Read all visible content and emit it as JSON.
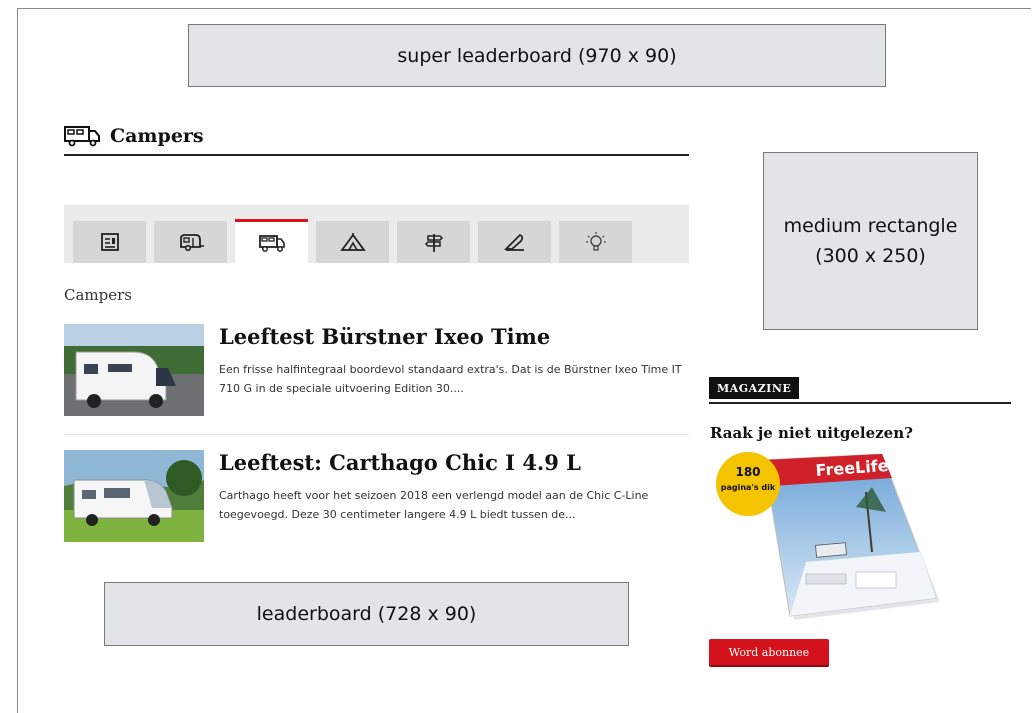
{
  "ads": {
    "super_leaderboard": "super leaderboard (970 x 90)",
    "medium_rectangle": "medium rectangle (300 x 250)",
    "leaderboard": "leaderboard (728 x 90)"
  },
  "section": {
    "title": "Campers",
    "icon": "camper-icon"
  },
  "tabs": [
    {
      "icon": "news-icon",
      "active": false
    },
    {
      "icon": "caravan-icon",
      "active": false
    },
    {
      "icon": "camper-icon",
      "active": true
    },
    {
      "icon": "tent-icon",
      "active": false
    },
    {
      "icon": "signpost-icon",
      "active": false
    },
    {
      "icon": "knife-icon",
      "active": false
    },
    {
      "icon": "lightbulb-icon",
      "active": false
    }
  ],
  "breadcrumb": "Campers",
  "articles": [
    {
      "title": "Leeftest Bürstner Ixeo Time",
      "excerpt": "Een frisse halfintegraal boordevol standaard extra's. Dat is de Bürstner Ixeo Time IT 710 G in de speciale uitvoering Edition 30...."
    },
    {
      "title": "Leeftest: Carthago Chic I 4.9 L",
      "excerpt": "Carthago heeft voor het seizoen 2018 een verlengd model aan de Chic C-Line toegevoegd. Deze 30 centimeter langere 4.9 L biedt tussen de..."
    }
  ],
  "magazine": {
    "label": "MAGAZINE",
    "heading": "Raak je niet uitgelezen?",
    "badge_number": "180",
    "badge_text": "pagina's dik",
    "brand": "FreeLife",
    "button": "Word abonnee"
  },
  "colors": {
    "accent": "#d9121c",
    "ad_placeholder": "#e3e4e6",
    "tab_bar": "#ebebeb",
    "badge": "#f5c400"
  }
}
